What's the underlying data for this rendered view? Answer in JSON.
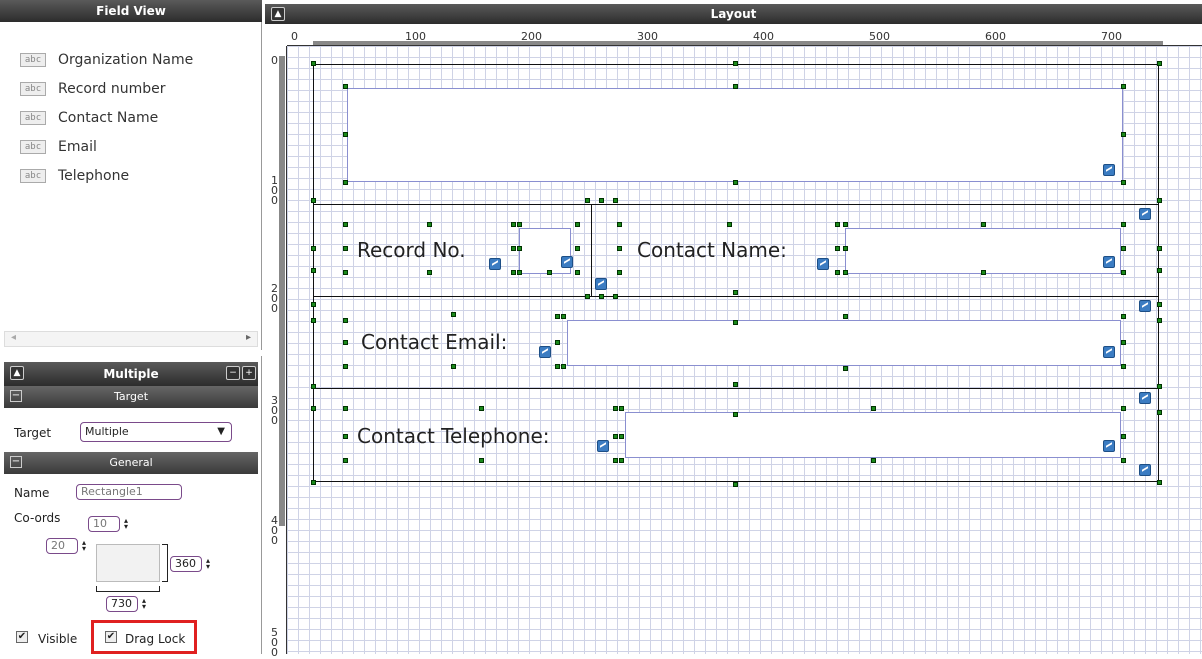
{
  "field_view": {
    "title": "Field View",
    "items": [
      "Organization Name",
      "Record number",
      "Contact Name",
      "Email",
      "Telephone"
    ],
    "item_icon": "abc"
  },
  "properties": {
    "title": "Multiple",
    "target_section": "Target",
    "target_label": "Target",
    "target_value": "Multiple",
    "general_section": "General",
    "name_label": "Name",
    "name_value": "Rectangle1",
    "coords_label": "Co-ords",
    "top": "10",
    "left": "20",
    "height": "360",
    "width": "730",
    "visible_label": "Visible",
    "drag_lock_label": "Drag Lock"
  },
  "layout": {
    "title": "Layout",
    "ruler_top": [
      "0",
      "100",
      "200",
      "300",
      "400",
      "500",
      "600",
      "700"
    ],
    "ruler_left": [
      "0",
      "100",
      "200",
      "300",
      "400",
      "500"
    ],
    "labels": {
      "record": "Record No.",
      "contact_name": "Contact Name:",
      "contact_email": "Contact Email:",
      "contact_telephone": "Contact Telephone:"
    }
  },
  "colors": {
    "header": "#3a3a3a",
    "handle": "#1a8a1a",
    "highlight": "#e02020",
    "grid": "#cfd3e6"
  }
}
